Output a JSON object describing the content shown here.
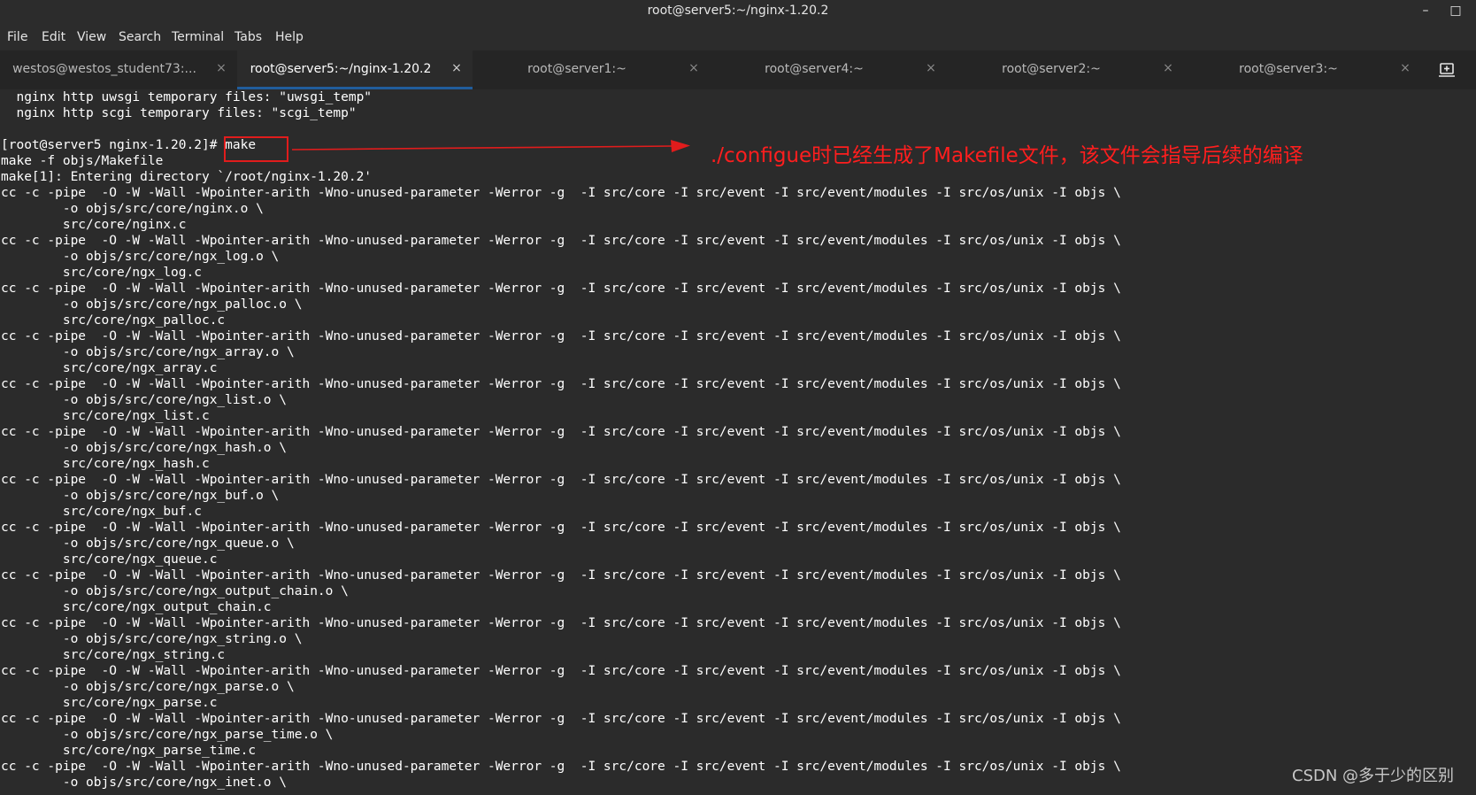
{
  "window": {
    "title": "root@server5:~/nginx-1.20.2",
    "minimize": "–",
    "maximize": "□"
  },
  "menu": [
    "File",
    "Edit",
    "View",
    "Search",
    "Terminal",
    "Tabs",
    "Help"
  ],
  "tabs": [
    {
      "label": "westos@westos_student73:...",
      "close": "×",
      "active": false
    },
    {
      "label": "root@server5:~/nginx-1.20.2",
      "close": "×",
      "active": true
    },
    {
      "label": "root@server1:~",
      "close": "×",
      "active": false
    },
    {
      "label": "root@server4:~",
      "close": "×",
      "active": false
    },
    {
      "label": "root@server2:~",
      "close": "×",
      "active": false
    },
    {
      "label": "root@server3:~",
      "close": "×",
      "active": false
    }
  ],
  "terminal": {
    "lines": [
      "  nginx http uwsgi temporary files: \"uwsgi_temp\"",
      "  nginx http scgi temporary files: \"scgi_temp\"",
      "",
      "[root@server5 nginx-1.20.2]# make",
      "make -f objs/Makefile",
      "make[1]: Entering directory `/root/nginx-1.20.2'",
      "cc -c -pipe  -O -W -Wall -Wpointer-arith -Wno-unused-parameter -Werror -g  -I src/core -I src/event -I src/event/modules -I src/os/unix -I objs \\",
      "        -o objs/src/core/nginx.o \\",
      "        src/core/nginx.c",
      "cc -c -pipe  -O -W -Wall -Wpointer-arith -Wno-unused-parameter -Werror -g  -I src/core -I src/event -I src/event/modules -I src/os/unix -I objs \\",
      "        -o objs/src/core/ngx_log.o \\",
      "        src/core/ngx_log.c",
      "cc -c -pipe  -O -W -Wall -Wpointer-arith -Wno-unused-parameter -Werror -g  -I src/core -I src/event -I src/event/modules -I src/os/unix -I objs \\",
      "        -o objs/src/core/ngx_palloc.o \\",
      "        src/core/ngx_palloc.c",
      "cc -c -pipe  -O -W -Wall -Wpointer-arith -Wno-unused-parameter -Werror -g  -I src/core -I src/event -I src/event/modules -I src/os/unix -I objs \\",
      "        -o objs/src/core/ngx_array.o \\",
      "        src/core/ngx_array.c",
      "cc -c -pipe  -O -W -Wall -Wpointer-arith -Wno-unused-parameter -Werror -g  -I src/core -I src/event -I src/event/modules -I src/os/unix -I objs \\",
      "        -o objs/src/core/ngx_list.o \\",
      "        src/core/ngx_list.c",
      "cc -c -pipe  -O -W -Wall -Wpointer-arith -Wno-unused-parameter -Werror -g  -I src/core -I src/event -I src/event/modules -I src/os/unix -I objs \\",
      "        -o objs/src/core/ngx_hash.o \\",
      "        src/core/ngx_hash.c",
      "cc -c -pipe  -O -W -Wall -Wpointer-arith -Wno-unused-parameter -Werror -g  -I src/core -I src/event -I src/event/modules -I src/os/unix -I objs \\",
      "        -o objs/src/core/ngx_buf.o \\",
      "        src/core/ngx_buf.c",
      "cc -c -pipe  -O -W -Wall -Wpointer-arith -Wno-unused-parameter -Werror -g  -I src/core -I src/event -I src/event/modules -I src/os/unix -I objs \\",
      "        -o objs/src/core/ngx_queue.o \\",
      "        src/core/ngx_queue.c",
      "cc -c -pipe  -O -W -Wall -Wpointer-arith -Wno-unused-parameter -Werror -g  -I src/core -I src/event -I src/event/modules -I src/os/unix -I objs \\",
      "        -o objs/src/core/ngx_output_chain.o \\",
      "        src/core/ngx_output_chain.c",
      "cc -c -pipe  -O -W -Wall -Wpointer-arith -Wno-unused-parameter -Werror -g  -I src/core -I src/event -I src/event/modules -I src/os/unix -I objs \\",
      "        -o objs/src/core/ngx_string.o \\",
      "        src/core/ngx_string.c",
      "cc -c -pipe  -O -W -Wall -Wpointer-arith -Wno-unused-parameter -Werror -g  -I src/core -I src/event -I src/event/modules -I src/os/unix -I objs \\",
      "        -o objs/src/core/ngx_parse.o \\",
      "        src/core/ngx_parse.c",
      "cc -c -pipe  -O -W -Wall -Wpointer-arith -Wno-unused-parameter -Werror -g  -I src/core -I src/event -I src/event/modules -I src/os/unix -I objs \\",
      "        -o objs/src/core/ngx_parse_time.o \\",
      "        src/core/ngx_parse_time.c",
      "cc -c -pipe  -O -W -Wall -Wpointer-arith -Wno-unused-parameter -Werror -g  -I src/core -I src/event -I src/event/modules -I src/os/unix -I objs \\",
      "        -o objs/src/core/ngx_inet.o \\"
    ]
  },
  "annotation": {
    "text": "./configue时已经生成了Makefile文件，该文件会指导后续的编译",
    "color": "#ff1e1e"
  },
  "watermark": "CSDN @多于少的区别",
  "colors": {
    "background": "#2b2b2b",
    "text": "#ffffff",
    "active_tab_indicator": "#215d9c",
    "annotation": "#ff1e1e"
  }
}
